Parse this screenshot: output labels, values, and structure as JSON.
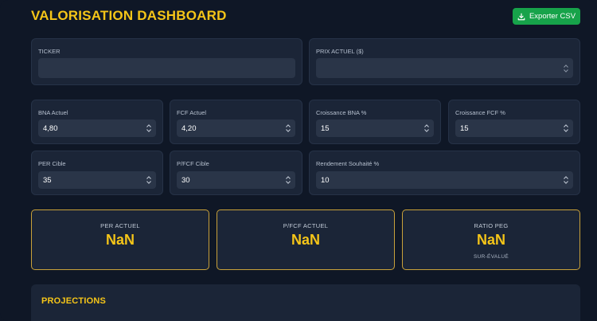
{
  "header": {
    "title": "VALORISATION DASHBOARD",
    "export_label": "Exporter CSV"
  },
  "inputs": {
    "ticker": {
      "label": "TICKER",
      "value": ""
    },
    "price": {
      "label": "PRIX ACTUEL ($)",
      "value": ""
    },
    "bna": {
      "label": "BNA Actuel",
      "value": "4,80"
    },
    "fcf": {
      "label": "FCF Actuel",
      "value": "4,20"
    },
    "growth_bna": {
      "label": "Croissance BNA %",
      "value": "15"
    },
    "growth_fcf": {
      "label": "Croissance FCF %",
      "value": "15"
    },
    "per_target": {
      "label": "PER Cible",
      "value": "35"
    },
    "pfcf_target": {
      "label": "P/FCF Cible",
      "value": "30"
    },
    "yield": {
      "label": "Rendement Souhaité %",
      "value": "10"
    }
  },
  "metrics": {
    "per": {
      "label": "PER ACTUEL",
      "value": "NaN"
    },
    "pfcf": {
      "label": "P/FCF ACTUEL",
      "value": "NaN"
    },
    "peg": {
      "label": "RATIO PEG",
      "value": "NaN",
      "status": "SUR-ÉVALUÉ"
    }
  },
  "projections": {
    "title": "PROJECTIONS"
  },
  "colors": {
    "accent": "#f5c518",
    "export_button": "#17a34a",
    "background": "#0f1726",
    "card": "#1b2537",
    "input": "#2a3548"
  }
}
